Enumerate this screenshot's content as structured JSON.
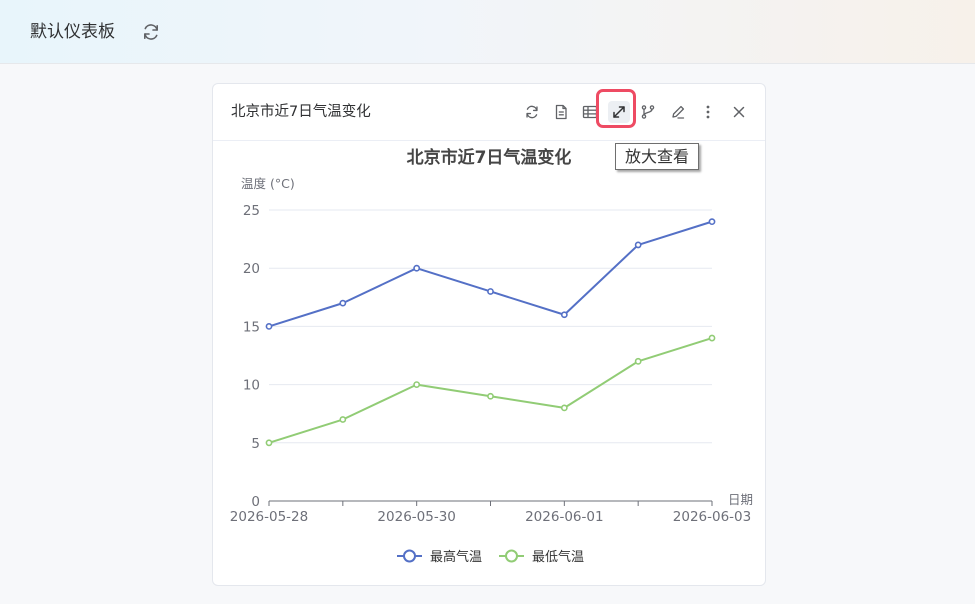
{
  "header": {
    "title": "默认仪表板",
    "refresh_icon": "refresh-icon"
  },
  "card": {
    "title": "北京市近7日气温变化",
    "tooltip": "放大查看",
    "toolbar_icons": [
      "refresh-icon",
      "document-icon",
      "table-icon",
      "expand-icon",
      "branch-icon",
      "edit-icon",
      "more-icon",
      "close-icon"
    ]
  },
  "colors": {
    "max": "#5470c6",
    "min": "#91cc75",
    "highlight": "#ee4b63"
  },
  "chart_data": {
    "type": "line",
    "title": "北京市近7日气温变化",
    "xlabel": "日期",
    "ylabel": "温度 (°C)",
    "x": [
      "2026-05-28",
      "2026-05-29",
      "2026-05-30",
      "2026-05-31",
      "2026-06-01",
      "2026-06-02",
      "2026-06-03"
    ],
    "xtick_labels": [
      "2026-05-28",
      "2026-05-30",
      "2026-06-01",
      "2026-06-03"
    ],
    "ylim": [
      0,
      25
    ],
    "yticks": [
      0,
      5,
      10,
      15,
      20,
      25
    ],
    "grid": true,
    "legend_position": "bottom",
    "series": [
      {
        "name": "最高气温",
        "values": [
          15,
          17,
          20,
          18,
          16,
          22,
          24
        ]
      },
      {
        "name": "最低气温",
        "values": [
          5,
          7,
          10,
          9,
          8,
          12,
          14
        ]
      }
    ]
  }
}
